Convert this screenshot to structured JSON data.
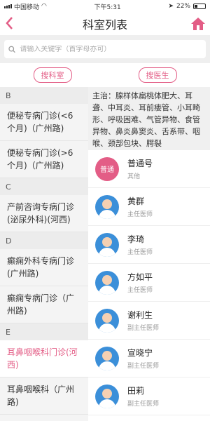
{
  "status_bar": {
    "carrier": "中国移动",
    "time": "下午5:31",
    "battery": "22%"
  },
  "header": {
    "title": "科室列表"
  },
  "search": {
    "placeholder": "请输入关键字（首字母亦可）"
  },
  "filters": {
    "search_department": "搜科室",
    "search_doctor": "搜医生"
  },
  "sidebar": [
    {
      "type": "header",
      "label": "B"
    },
    {
      "type": "item",
      "label": "便秘专病门诊(<6个月)（广州路)"
    },
    {
      "type": "item",
      "label": "便秘专病门诊(>6个月)（广州路)"
    },
    {
      "type": "header",
      "label": "C"
    },
    {
      "type": "item",
      "label": "产前咨询专病门诊(泌尿外科)(河西)"
    },
    {
      "type": "header",
      "label": "D"
    },
    {
      "type": "item",
      "label": "癫痫外科专病门诊(广州路)"
    },
    {
      "type": "item",
      "label": "癫痫专病门诊（广州路)"
    },
    {
      "type": "header",
      "label": "E"
    },
    {
      "type": "item",
      "label": "耳鼻咽喉科门诊(河西)",
      "selected": true
    },
    {
      "type": "item",
      "label": "耳鼻咽喉科（广州路)"
    }
  ],
  "department": {
    "description": "主治：腺样体扁桃体肥大、耳聋、中耳炎、耳前瘘管、小耳畸形、呼吸困难、气管异物、食管异物、鼻炎鼻窦炎、舌系带、咽喉、颈部包块、腭裂"
  },
  "doctors": [
    {
      "name": "普通号",
      "title": "其他",
      "avatar": "普通"
    },
    {
      "name": "黄群",
      "title": "主任医师"
    },
    {
      "name": "李琦",
      "title": "主任医师"
    },
    {
      "name": "方如平",
      "title": "主任医师"
    },
    {
      "name": "谢利生",
      "title": "副主任医师"
    },
    {
      "name": "宣晓宁",
      "title": "副主任医师"
    },
    {
      "name": "田莉",
      "title": "副主任医师"
    }
  ],
  "colors": {
    "accent": "#e35d86",
    "avatar_blue": "#3b8fd9"
  },
  "icons": {
    "back": "chevron-left-icon",
    "home": "home-icon",
    "search": "search-icon"
  }
}
